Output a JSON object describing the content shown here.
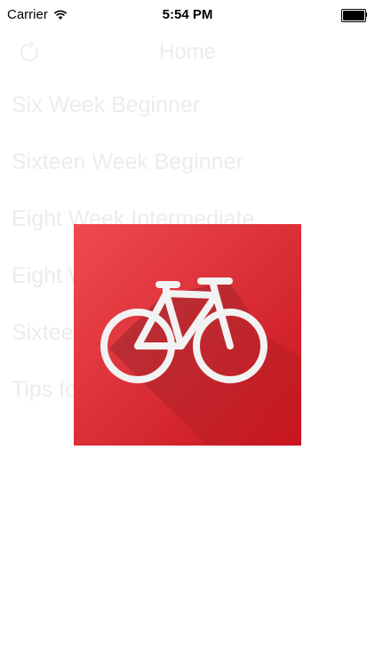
{
  "status_bar": {
    "carrier": "Carrier",
    "time": "5:54 PM",
    "wifi_icon": "wifi-icon",
    "battery_icon": "battery-icon",
    "battery_level": 1.0
  },
  "nav": {
    "title": "Home",
    "left_icon": "refresh-icon"
  },
  "menu": {
    "items": [
      {
        "label": "Six Week Beginner"
      },
      {
        "label": "Sixteen Week Beginner"
      },
      {
        "label": "Eight Week Intermediate"
      },
      {
        "label": "Eight Week Advanced"
      },
      {
        "label": "Sixteen Week Advanced"
      },
      {
        "label": "Tips for Training"
      }
    ]
  },
  "splash": {
    "icon": "bicycle-icon",
    "colors": {
      "background_top": "#ef4a51",
      "background_bottom": "#c8151d",
      "bike": "#f2f2f2"
    }
  }
}
